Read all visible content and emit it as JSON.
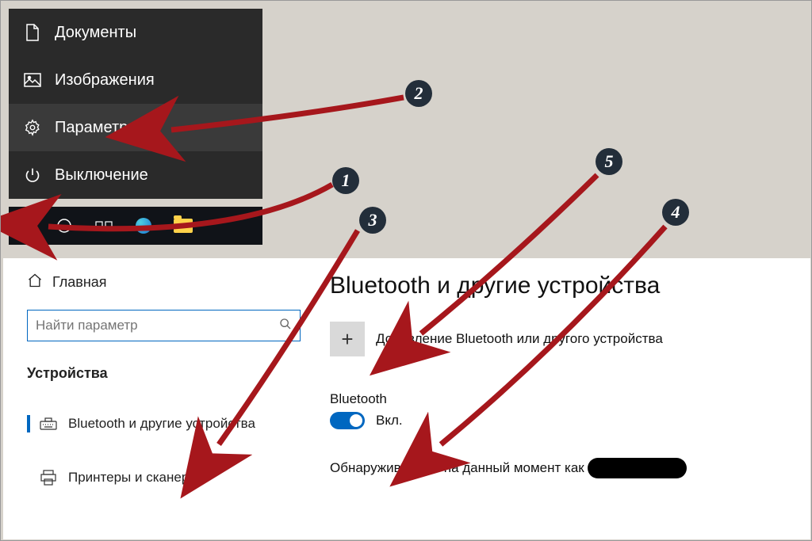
{
  "start_menu": {
    "items": [
      {
        "icon": "document-icon",
        "label": "Документы"
      },
      {
        "icon": "image-icon",
        "label": "Изображения"
      },
      {
        "icon": "gear-icon",
        "label": "Параметры"
      },
      {
        "icon": "power-icon",
        "label": "Выключение"
      }
    ]
  },
  "taskbar": {
    "icons": [
      "start-icon",
      "circle-icon",
      "task-view-icon",
      "edge-icon",
      "file-explorer-icon"
    ]
  },
  "settings": {
    "home": "Главная",
    "search_placeholder": "Найти параметр",
    "category_title": "Устройства",
    "items": [
      {
        "icon": "keyboard-icon",
        "label": "Bluetooth и другие устройства",
        "active": true
      },
      {
        "icon": "printer-icon",
        "label": "Принтеры и сканеры",
        "active": false
      }
    ]
  },
  "bluetooth_page": {
    "title": "Bluetooth и другие устройства",
    "add_label": "Добавление Bluetooth или другого устройства",
    "section_label": "Bluetooth",
    "toggle_state": "Вкл.",
    "discoverable_prefix": "Обнаруживаемое на данный момент как"
  },
  "steps": [
    "1",
    "2",
    "3",
    "4",
    "5"
  ],
  "colors": {
    "accent": "#0067c0",
    "arrow": "#a6171c",
    "badge": "#232e3a",
    "start_bg": "#2a2a2a"
  }
}
